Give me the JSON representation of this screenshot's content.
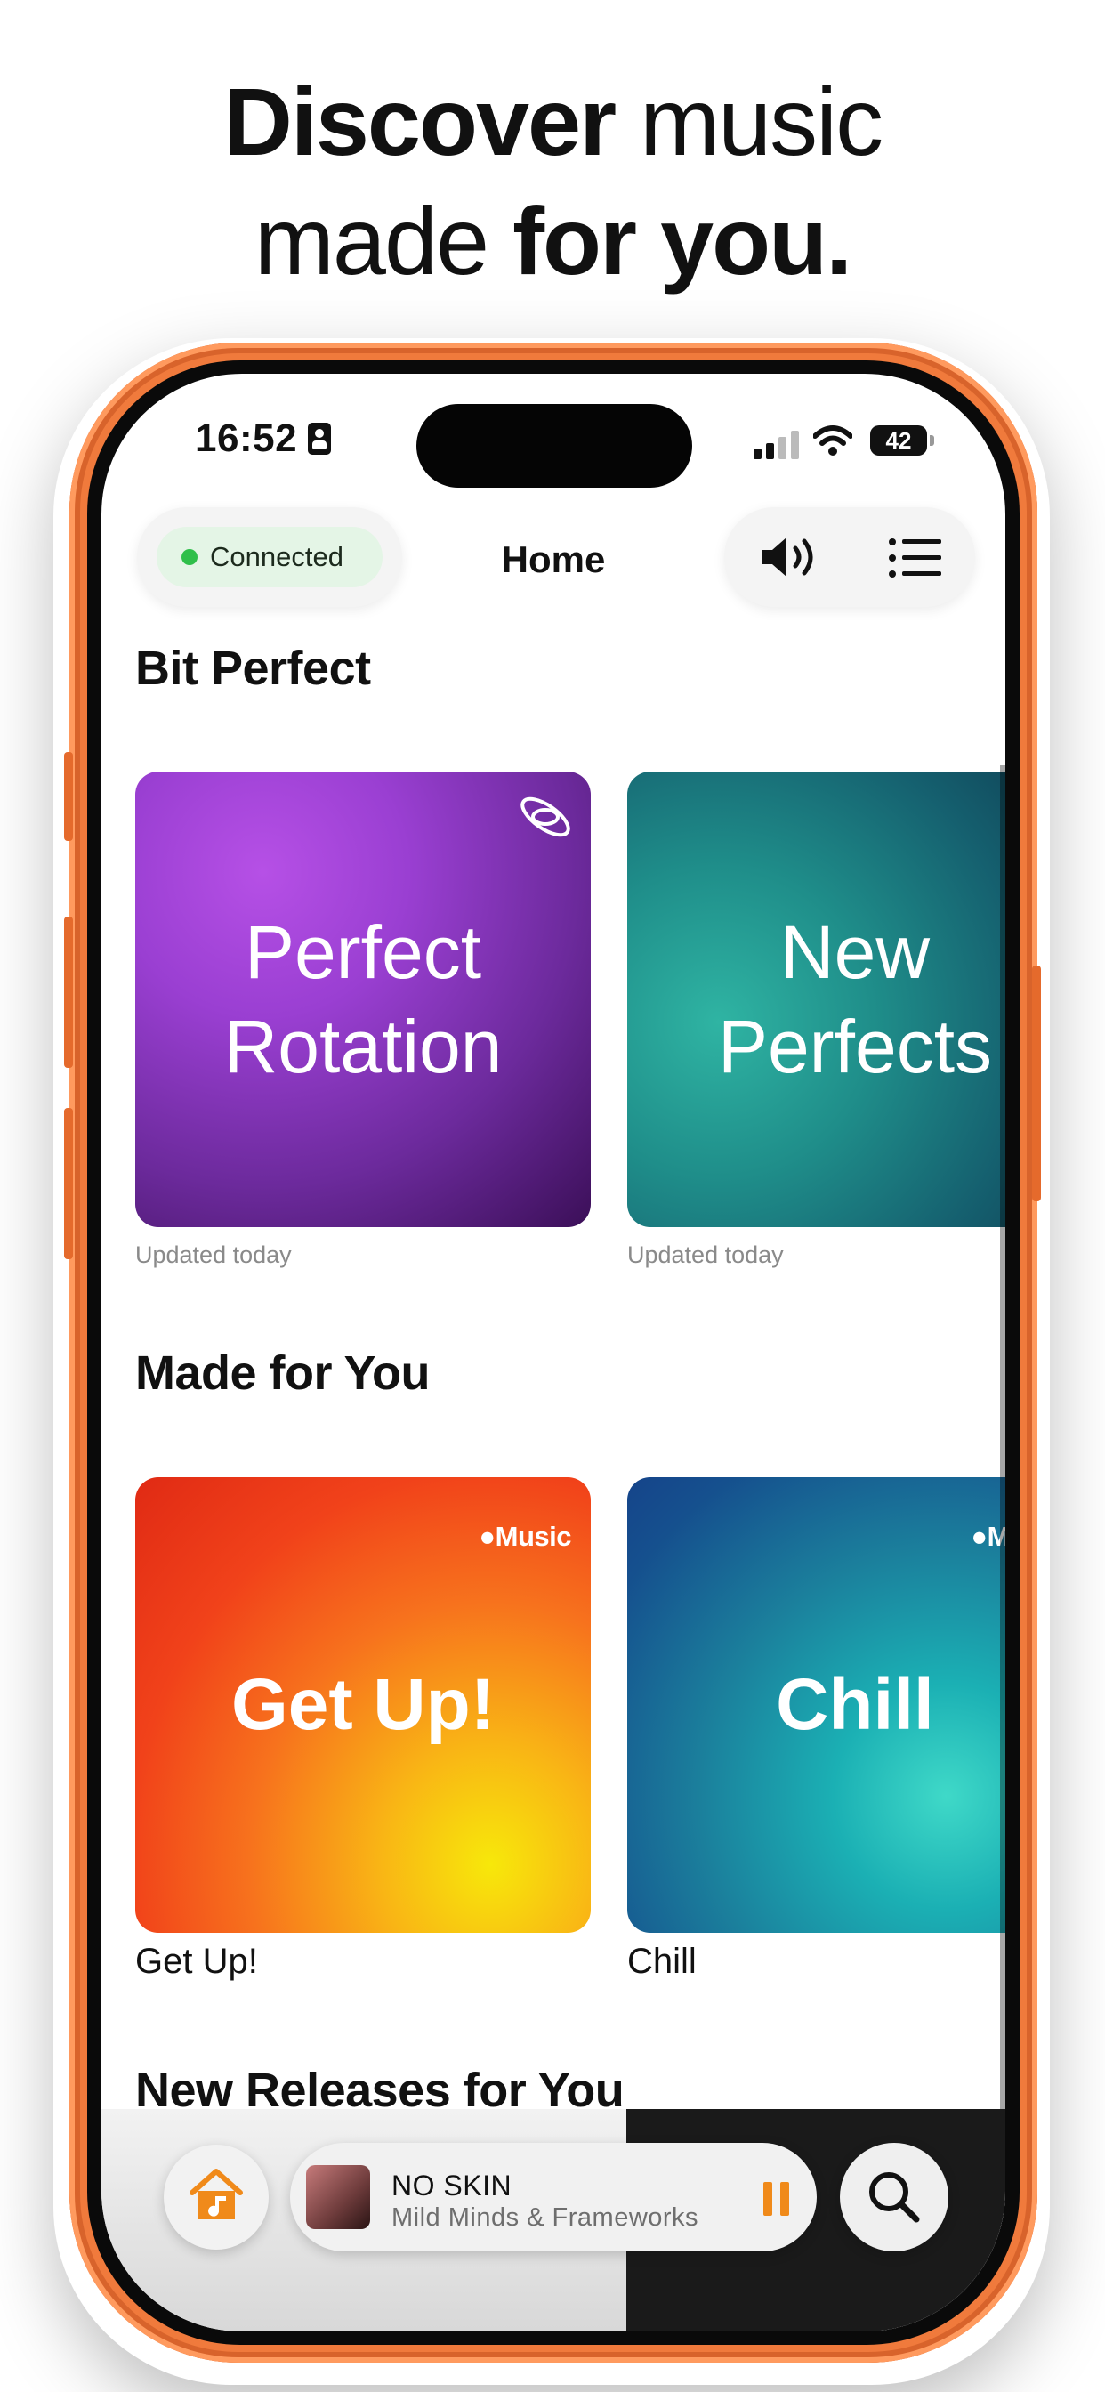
{
  "headline": {
    "line1_bold": "Discover",
    "line1_regular": " music",
    "line2_regular": "made ",
    "line2_bold": "for you."
  },
  "status_bar": {
    "time": "16:52",
    "battery": "42"
  },
  "nav": {
    "connection_status": "Connected",
    "title": "Home",
    "icons": [
      "speaker-icon",
      "menu-list-icon"
    ]
  },
  "sections": {
    "bit_perfect": {
      "title": "Bit Perfect",
      "cards": [
        {
          "title": "Perfect\nRotation",
          "caption": "Updated today"
        },
        {
          "title": "New\nPerfects",
          "caption": "Updated today"
        }
      ]
    },
    "made_for_you": {
      "title": "Made for You",
      "badge": "Music",
      "cards": [
        {
          "title": "Get Up!",
          "label": "Get Up!"
        },
        {
          "title": "Chill",
          "label": "Chill"
        }
      ]
    },
    "new_releases": {
      "title": "New Releases for You"
    }
  },
  "now_playing": {
    "title": "NO SKIN",
    "artist": "Mild Minds & Frameworks",
    "state": "playing"
  },
  "colors": {
    "accent": "#f08a1a",
    "phone_frame": "#f07a3c",
    "connected_dot": "#2fbf4a"
  }
}
